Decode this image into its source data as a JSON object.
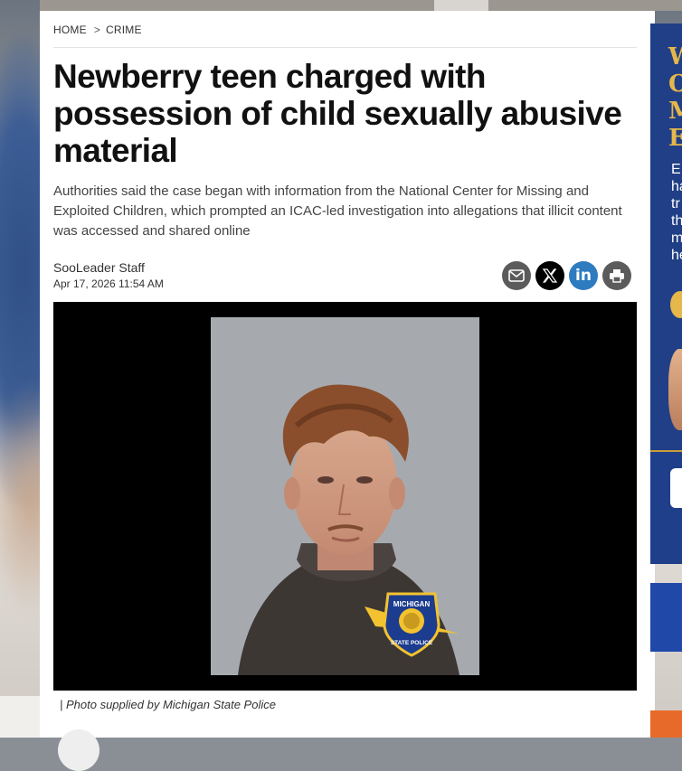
{
  "breadcrumb": {
    "home": "HOME",
    "separator": ">",
    "section": "CRIME"
  },
  "article": {
    "headline": "Newberry teen charged with possession of child sexually abusive material",
    "subheadline": "Authorities said the case began with information from the National Center for Missing and Exploited Children, which prompted an ICAC-led investigation into allegations that illicit content was accessed and shared online",
    "author": "SooLeader Staff",
    "date": "Apr 17, 2026 11:54 AM",
    "photo_caption": "| Photo supplied by Michigan State Police",
    "photo_badge": {
      "top": "MICHIGAN",
      "bottom": "STATE POLICE"
    }
  },
  "share_buttons": [
    {
      "name": "email",
      "icon": "envelope-icon"
    },
    {
      "name": "x",
      "icon": "x-logo-icon"
    },
    {
      "name": "linkedin",
      "icon": "linkedin-icon",
      "label": "in"
    },
    {
      "name": "print",
      "icon": "printer-icon"
    }
  ],
  "ad": {
    "letters": [
      "W",
      "O",
      "M",
      "E"
    ],
    "text_lines": [
      "E",
      "ha",
      "tr",
      "th",
      "m",
      "he"
    ]
  },
  "colors": {
    "linkedin": "#2f7bbf",
    "ad_blue": "#1f3f8a",
    "ad_gold": "#e6b74a",
    "ad_orange": "#e86a2b"
  }
}
